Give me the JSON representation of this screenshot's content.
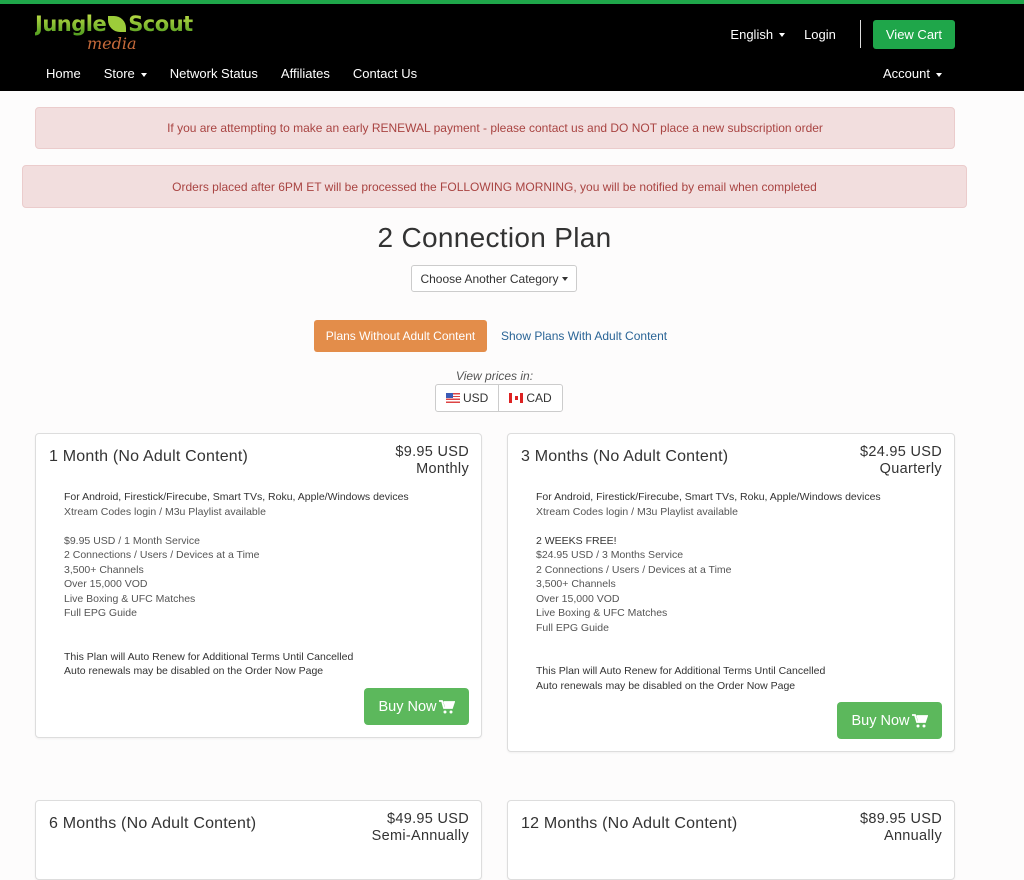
{
  "brand": {
    "name_main": "Jungle",
    "name_secondary": "Scout",
    "subtitle": "media",
    "accent_color": "#1fa64a"
  },
  "header": {
    "language": "English",
    "login": "Login",
    "view_cart": "View Cart",
    "account": "Account"
  },
  "nav": {
    "items": [
      {
        "label": "Home",
        "dropdown": false
      },
      {
        "label": "Store",
        "dropdown": true
      },
      {
        "label": "Network Status",
        "dropdown": false
      },
      {
        "label": "Affiliates",
        "dropdown": false
      },
      {
        "label": "Contact Us",
        "dropdown": false
      }
    ]
  },
  "alerts": [
    "If you are attempting to make an early RENEWAL payment - please contact us and DO NOT place a new subscription order",
    "Orders placed after 6PM ET will be processed the FOLLOWING MORNING, you will be notified by email when completed"
  ],
  "main": {
    "title": "2 Connection Plan",
    "category_dropdown": "Choose Another Category",
    "filter_active": "Plans Without Adult Content",
    "filter_link": "Show Plans With Adult Content",
    "view_prices_label": "View prices in:",
    "currencies": [
      {
        "code": "USD",
        "icon": "us-flag-icon"
      },
      {
        "code": "CAD",
        "icon": "ca-flag-icon"
      }
    ],
    "buy_label": "Buy Now"
  },
  "plans": [
    {
      "name": "1 Month (No Adult Content)",
      "price": "$9.95 USD",
      "cycle": "Monthly",
      "devices": "For Android, Firestick/Firecube, Smart TVs, Roku, Apple/Windows devices",
      "login": "Xtream Codes login / M3u Playlist available",
      "promo": "",
      "features": [
        "$9.95 USD / 1 Month Service",
        "2 Connections / Users / Devices at a Time",
        "3,500+ Channels",
        "Over 15,000 VOD",
        "Live Boxing & UFC Matches",
        "Full EPG Guide"
      ],
      "renew_1": "This Plan will Auto Renew for Additional Terms Until Cancelled",
      "renew_2": "Auto renewals may be disabled on the Order Now Page"
    },
    {
      "name": "3 Months (No Adult Content)",
      "price": "$24.95 USD",
      "cycle": "Quarterly",
      "devices": "For Android, Firestick/Firecube, Smart TVs, Roku, Apple/Windows devices",
      "login": "Xtream Codes login / M3u Playlist available",
      "promo": "2 WEEKS FREE!",
      "features": [
        "$24.95 USD / 3 Months Service",
        "2 Connections / Users / Devices at a Time",
        "3,500+ Channels",
        "Over 15,000 VOD",
        "Live Boxing & UFC Matches",
        "Full EPG Guide"
      ],
      "renew_1": "This Plan will Auto Renew for Additional Terms Until Cancelled",
      "renew_2": "Auto renewals may be disabled on the Order Now Page"
    },
    {
      "name": "6 Months (No Adult Content)",
      "price": "$49.95 USD",
      "cycle": "Semi-Annually"
    },
    {
      "name": "12 Months (No Adult Content)",
      "price": "$89.95 USD",
      "cycle": "Annually"
    }
  ]
}
